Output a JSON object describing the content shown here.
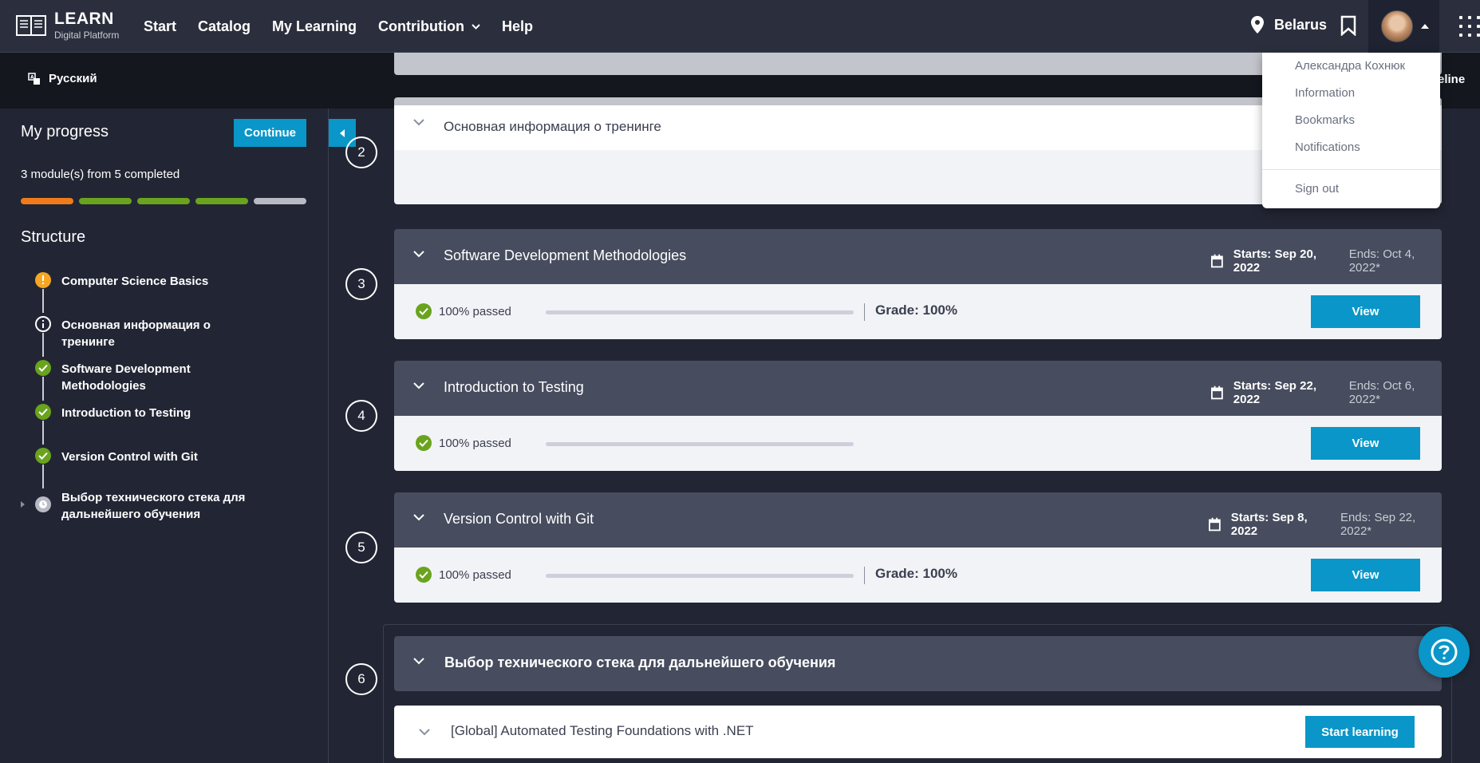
{
  "header": {
    "logo_title": "LEARN",
    "logo_sub": "Digital Platform",
    "nav": [
      "Start",
      "Catalog",
      "My Learning",
      "Contribution",
      "Help"
    ],
    "location": "Belarus"
  },
  "subbar": {
    "language": "Русский",
    "timeline_fragment": "eline"
  },
  "sidebar": {
    "title": "My progress",
    "continue_label": "Continue",
    "modules_text": "3 module(s) from 5 completed",
    "progress_segments": [
      {
        "status": "warning",
        "color": "#f07b1a"
      },
      {
        "status": "done",
        "color": "#6aa31d"
      },
      {
        "status": "done",
        "color": "#6aa31d"
      },
      {
        "status": "done",
        "color": "#6aa31d"
      },
      {
        "status": "pending",
        "color": "#b7b9c3"
      }
    ],
    "structure_title": "Structure",
    "items": [
      {
        "label": "Computer Science Basics",
        "icon": "warning-icon"
      },
      {
        "label": "Основная информация о тренинге",
        "icon": "info-icon"
      },
      {
        "label": "Software Development Methodologies",
        "icon": "check-icon"
      },
      {
        "label": "Introduction to Testing",
        "icon": "check-icon"
      },
      {
        "label": "Version Control with Git",
        "icon": "check-icon"
      },
      {
        "label": "Выбор технического стека для дальнейшего обучения",
        "icon": "clock-icon"
      }
    ]
  },
  "main": {
    "steps": [
      "2",
      "3",
      "4",
      "5",
      "6"
    ],
    "card2_title": "Основная информация о тренинге",
    "cards": [
      {
        "title": "Software Development Methodologies",
        "start": "Starts: Sep 20, 2022",
        "end": "Ends: Oct 4, 2022*",
        "passed": "100% passed",
        "grade": "Grade: 100%",
        "view": "View"
      },
      {
        "title": "Introduction to Testing",
        "start": "Starts: Sep 22, 2022",
        "end": "Ends: Oct 6, 2022*",
        "passed": "100% passed",
        "grade": "",
        "view": "View"
      },
      {
        "title": "Version Control with Git",
        "start": "Starts: Sep 8, 2022",
        "end": "Ends: Sep 22, 2022*",
        "passed": "100% passed",
        "grade": "Grade: 100%",
        "view": "View"
      }
    ],
    "card6_title": "Выбор технического стека для дальнейшего обучения",
    "sub_card_title": "[Global] Automated Testing Foundations with .NET",
    "start_learning": "Start learning"
  },
  "dropdown": {
    "user_name": "Александра Кохнюк",
    "items": [
      "Information",
      "Bookmarks",
      "Notifications"
    ],
    "sign_out": "Sign out"
  },
  "colors": {
    "accent": "#0a96c8",
    "success": "#6aa31d",
    "warning": "#f5a623"
  }
}
